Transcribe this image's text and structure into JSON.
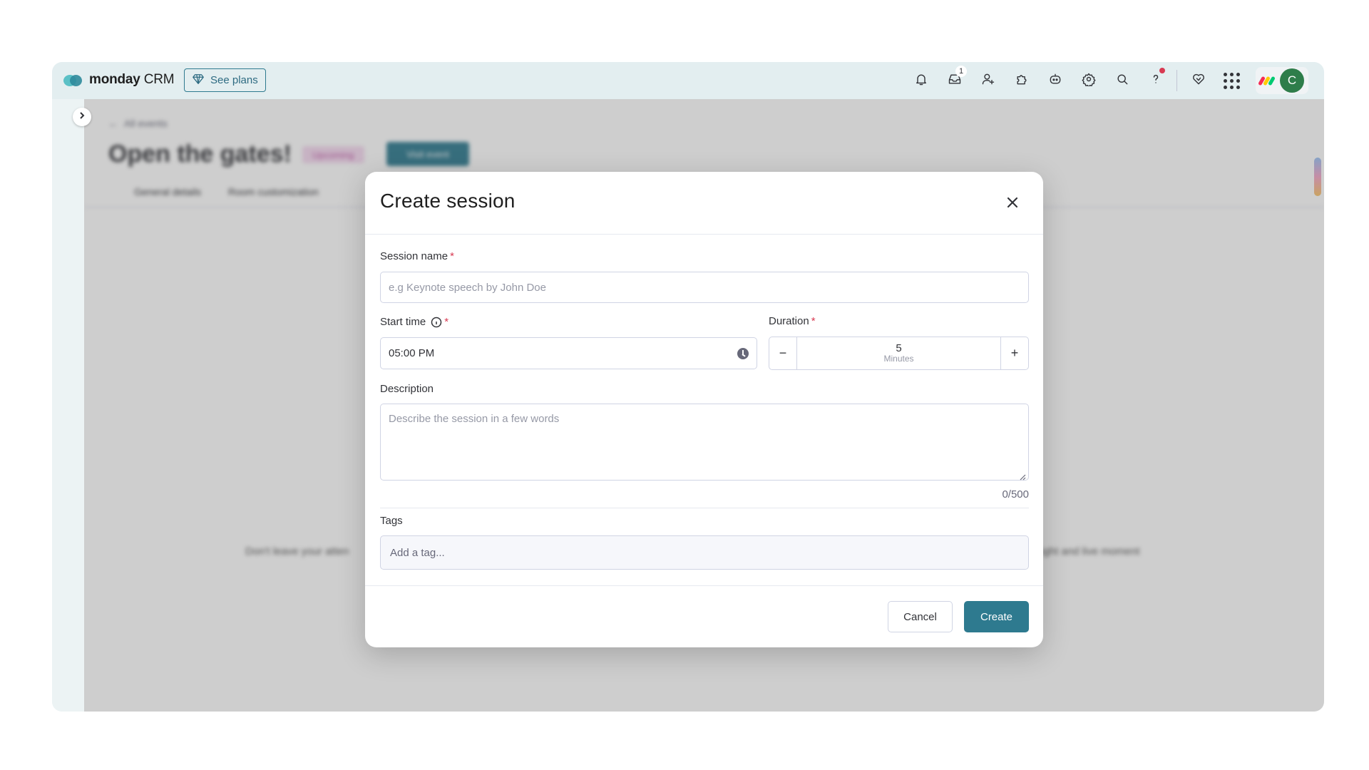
{
  "app": {
    "brand_bold": "monday",
    "brand_light": " CRM",
    "see_plans_label": "See plans"
  },
  "topbar": {
    "icons": [
      "bell-icon",
      "inbox-icon",
      "invite-user-icon",
      "integrations-icon",
      "ai-assistant-icon",
      "settings-icon",
      "search-icon",
      "help-icon",
      "favorites-icon",
      "apps-grid-icon"
    ],
    "inbox_badge": "1",
    "avatar_initial": "C",
    "colors": {
      "accent": "#2e7a8f",
      "avatar": "#2e7d4a",
      "alert_dot": "#d83a52"
    }
  },
  "background_page": {
    "back_link": "All events",
    "title": "Open the gates!",
    "status_pill": "Upcoming",
    "action_button": "Visit event",
    "tabs": [
      "General details",
      "Room customization"
    ],
    "center_text_left": "Don't leave your atten",
    "center_text_right": "ight and live moment"
  },
  "modal": {
    "title": "Create session",
    "session_name": {
      "label": "Session name",
      "required_mark": "*",
      "placeholder": "e.g Keynote speech by John Doe",
      "value": ""
    },
    "start_time": {
      "label": "Start time",
      "required_mark": "*",
      "value": "05:00 PM"
    },
    "duration": {
      "label": "Duration",
      "required_mark": "*",
      "minus": "−",
      "plus": "+",
      "value": "5",
      "unit": "Minutes"
    },
    "description": {
      "label": "Description",
      "placeholder": "Describe the session in a few words",
      "counter": "0/500"
    },
    "tags": {
      "label": "Tags",
      "placeholder": "Add a tag..."
    },
    "cancel_label": "Cancel",
    "create_label": "Create"
  }
}
